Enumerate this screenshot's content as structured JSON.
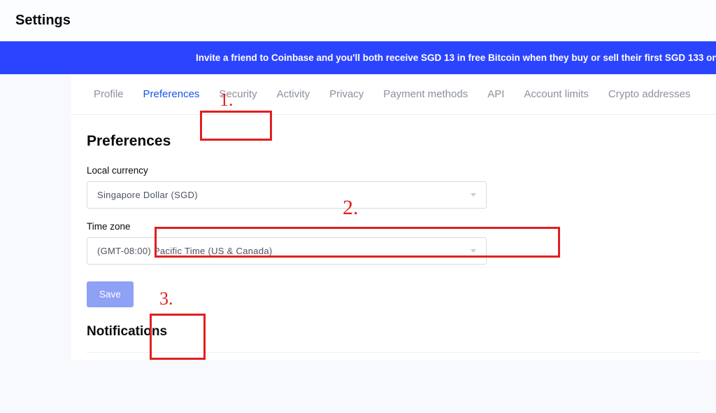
{
  "page": {
    "title": "Settings"
  },
  "banner": {
    "text": "Invite a friend to Coinbase and you'll both receive SGD 13 in free Bitcoin when they buy or sell their first SGD 133 on"
  },
  "tabs": [
    {
      "label": "Profile"
    },
    {
      "label": "Preferences"
    },
    {
      "label": "Security"
    },
    {
      "label": "Activity"
    },
    {
      "label": "Privacy"
    },
    {
      "label": "Payment methods"
    },
    {
      "label": "API"
    },
    {
      "label": "Account limits"
    },
    {
      "label": "Crypto addresses"
    }
  ],
  "preferences": {
    "heading": "Preferences",
    "currency_label": "Local currency",
    "currency_value": "Singapore Dollar (SGD)",
    "timezone_label": "Time zone",
    "timezone_value": "(GMT-08:00) Pacific Time (US & Canada)",
    "save_label": "Save"
  },
  "notifications": {
    "heading": "Notifications"
  },
  "annotations": {
    "a1": "1.",
    "a2": "2.",
    "a3": "3."
  }
}
